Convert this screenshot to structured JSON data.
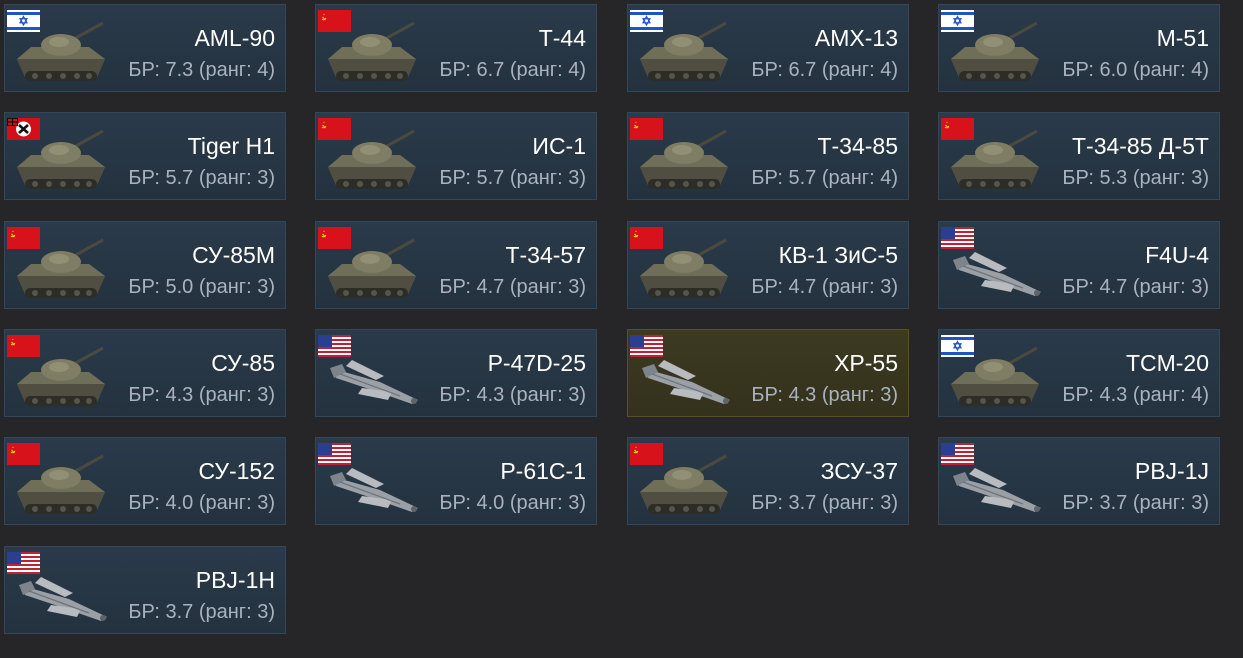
{
  "colors": {
    "card_bg": "#2a3a4a",
    "card_highlight_bg": "#3d3a22",
    "page_bg": "#262629",
    "name_text": "#ffffff",
    "br_text": "#a8b3bf"
  },
  "vehicles": [
    {
      "name": "AML-90",
      "br": "БР: 7.3 (ранг: 4)",
      "flag": "israel",
      "kind": "tank",
      "highlighted": false
    },
    {
      "name": "Т-44",
      "br": "БР: 6.7 (ранг: 4)",
      "flag": "ussr",
      "kind": "tank",
      "highlighted": false
    },
    {
      "name": "AMX-13",
      "br": "БР: 6.7 (ранг: 4)",
      "flag": "israel",
      "kind": "tank",
      "highlighted": false
    },
    {
      "name": "M-51",
      "br": "БР: 6.0 (ранг: 4)",
      "flag": "israel",
      "kind": "tank",
      "highlighted": false
    },
    {
      "name": "Tiger H1",
      "br": "БР: 5.7 (ранг: 3)",
      "flag": "germany",
      "kind": "tank",
      "highlighted": false
    },
    {
      "name": "ИС-1",
      "br": "БР: 5.7 (ранг: 3)",
      "flag": "ussr",
      "kind": "tank",
      "highlighted": false
    },
    {
      "name": "Т-34-85",
      "br": "БР: 5.7 (ранг: 4)",
      "flag": "ussr",
      "kind": "tank",
      "highlighted": false
    },
    {
      "name": "Т-34-85 Д-5Т",
      "br": "БР: 5.3 (ранг: 3)",
      "flag": "ussr",
      "kind": "tank",
      "highlighted": false
    },
    {
      "name": "СУ-85М",
      "br": "БР: 5.0 (ранг: 3)",
      "flag": "ussr",
      "kind": "tank",
      "highlighted": false
    },
    {
      "name": "Т-34-57",
      "br": "БР: 4.7 (ранг: 3)",
      "flag": "ussr",
      "kind": "tank",
      "highlighted": false
    },
    {
      "name": "КВ-1 ЗиС-5",
      "br": "БР: 4.7 (ранг: 3)",
      "flag": "ussr",
      "kind": "tank",
      "highlighted": false
    },
    {
      "name": "F4U-4",
      "br": "БР: 4.7 (ранг: 3)",
      "flag": "usa",
      "kind": "plane",
      "highlighted": false
    },
    {
      "name": "СУ-85",
      "br": "БР: 4.3 (ранг: 3)",
      "flag": "ussr",
      "kind": "tank",
      "highlighted": false
    },
    {
      "name": "P-47D-25",
      "br": "БР: 4.3 (ранг: 3)",
      "flag": "usa",
      "kind": "plane",
      "highlighted": false
    },
    {
      "name": "XP-55",
      "br": "БР: 4.3 (ранг: 3)",
      "flag": "usa",
      "kind": "plane",
      "highlighted": true
    },
    {
      "name": "TCM-20",
      "br": "БР: 4.3 (ранг: 4)",
      "flag": "israel",
      "kind": "tank",
      "highlighted": false
    },
    {
      "name": "СУ-152",
      "br": "БР: 4.0 (ранг: 3)",
      "flag": "ussr",
      "kind": "tank",
      "highlighted": false
    },
    {
      "name": "P-61C-1",
      "br": "БР: 4.0 (ранг: 3)",
      "flag": "usa",
      "kind": "plane",
      "highlighted": false
    },
    {
      "name": "ЗСУ-37",
      "br": "БР: 3.7 (ранг: 3)",
      "flag": "ussr",
      "kind": "tank",
      "highlighted": false
    },
    {
      "name": "PBJ-1J",
      "br": "БР: 3.7 (ранг: 3)",
      "flag": "usa",
      "kind": "plane",
      "highlighted": false
    },
    {
      "name": "PBJ-1H",
      "br": "БР: 3.7 (ранг: 3)",
      "flag": "usa",
      "kind": "plane",
      "highlighted": false
    }
  ]
}
